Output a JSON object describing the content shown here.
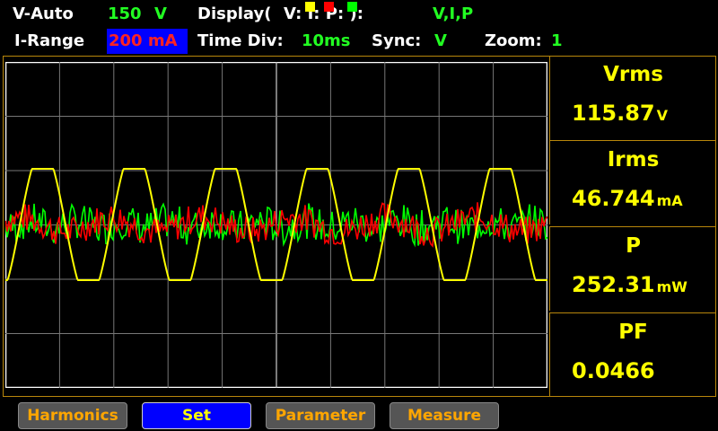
{
  "status": {
    "v_range_label": "V-Auto",
    "v_range_value": "150",
    "v_range_unit": "V",
    "display_label": "Display(",
    "display_v": "V:",
    "display_i": "I:",
    "display_p": "P:",
    "display_close": "):",
    "display_value": "V,I,P",
    "i_range_label": "I-Range",
    "i_range_value": "200 mA",
    "time_div_label": "Time Div:",
    "time_div_value": "10ms",
    "sync_label": "Sync:",
    "sync_value": "V",
    "zoom_label": "Zoom:",
    "zoom_value": "1"
  },
  "colors": {
    "voltage": "#ffff00",
    "current": "#ff0000",
    "power": "#00ff00",
    "accent": "#b8860b"
  },
  "measurements": [
    {
      "label": "Vrms",
      "value": "115.87",
      "unit": "V"
    },
    {
      "label": "Irms",
      "value": "46.744",
      "unit": "mA"
    },
    {
      "label": "P",
      "value": "252.31",
      "unit": "mW"
    },
    {
      "label": "PF",
      "value": "0.0466",
      "unit": ""
    }
  ],
  "buttons": [
    {
      "label": "Harmonics",
      "active": false
    },
    {
      "label": "Set",
      "active": true
    },
    {
      "label": "Parameter",
      "active": false
    },
    {
      "label": "Measure",
      "active": false
    }
  ]
}
